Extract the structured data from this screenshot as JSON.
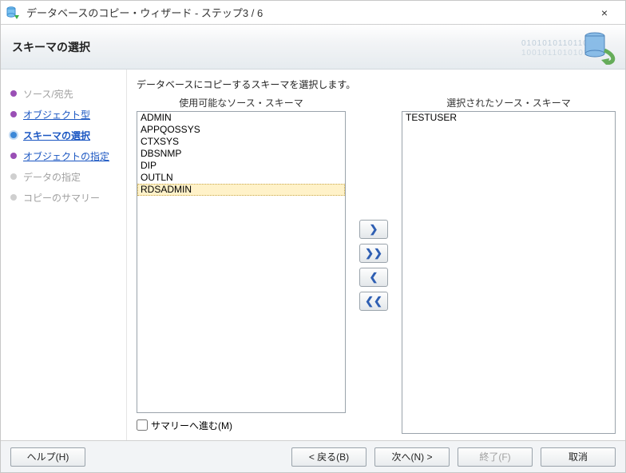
{
  "window": {
    "title": "データベースのコピー・ウィザード - ステップ3 / 6",
    "close_icon": "×"
  },
  "banner": {
    "heading": "スキーマの選択"
  },
  "steps": {
    "s1": {
      "label": "ソース/宛先",
      "state": "done-disabled"
    },
    "s2": {
      "label": "オブジェクト型",
      "state": "done-link"
    },
    "s3": {
      "label": "スキーマの選択",
      "state": "current"
    },
    "s4": {
      "label": "オブジェクトの指定",
      "state": "done-link"
    },
    "s5": {
      "label": "データの指定",
      "state": "future"
    },
    "s6": {
      "label": "コピーのサマリー",
      "state": "future"
    }
  },
  "content": {
    "instruction": "データベースにコピーするスキーマを選択します。",
    "available_label": "使用可能なソース・スキーマ",
    "selected_label": "選択されたソース・スキーマ",
    "available_items": [
      "ADMIN",
      "APPQOSSYS",
      "CTXSYS",
      "DBSNMP",
      "DIP",
      "OUTLN",
      "RDSADMIN"
    ],
    "available_selected_index": 6,
    "selected_items": [
      "TESTUSER"
    ],
    "move_right": "❯",
    "move_right_all": "❯❯",
    "move_left": "❮",
    "move_left_all": "❮❮",
    "summary_checkbox_label": "サマリーへ進む(M)",
    "summary_checked": false
  },
  "footer": {
    "help": "ヘルプ(H)",
    "back": "< 戻る(B)",
    "next": "次へ(N) >",
    "finish": "終了(F)",
    "cancel": "取消"
  }
}
